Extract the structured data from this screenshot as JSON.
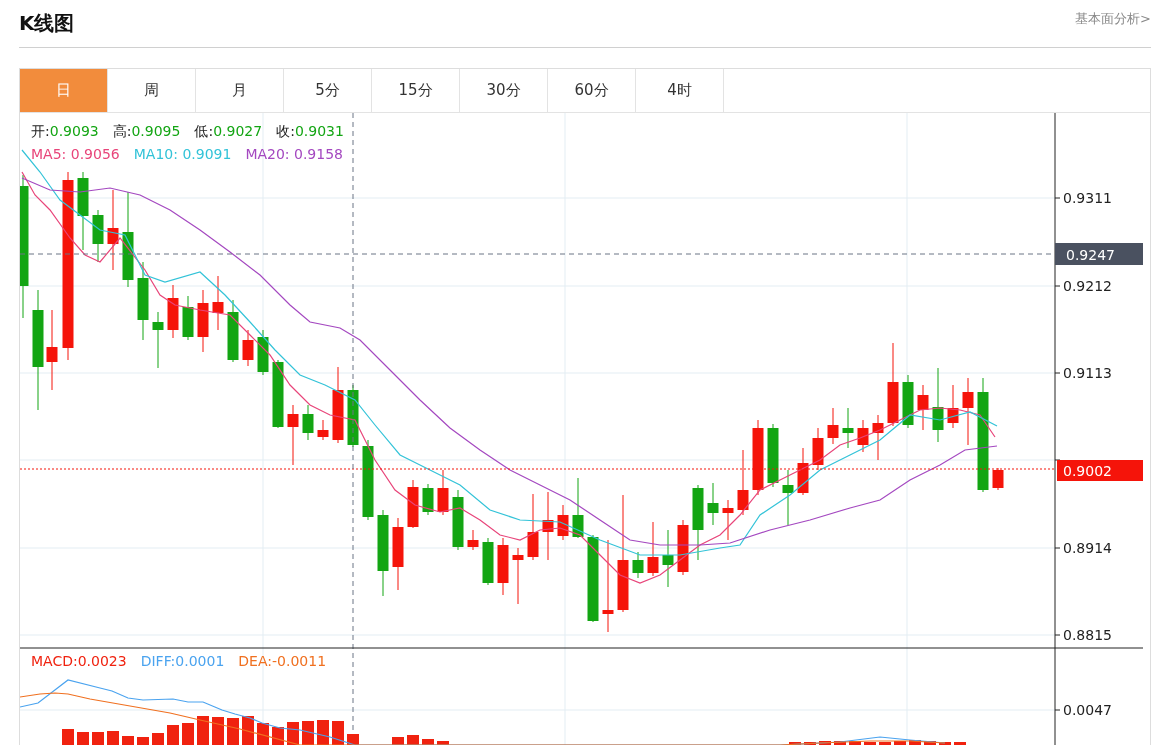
{
  "header": {
    "title": "K线图",
    "link": "基本面分析>"
  },
  "tabs": [
    {
      "label": "日",
      "selected": true
    },
    {
      "label": "周",
      "selected": false
    },
    {
      "label": "月",
      "selected": false
    },
    {
      "label": "5分",
      "selected": false
    },
    {
      "label": "15分",
      "selected": false
    },
    {
      "label": "30分",
      "selected": false
    },
    {
      "label": "60分",
      "selected": false
    },
    {
      "label": "4时",
      "selected": false
    }
  ],
  "ohlc": [
    {
      "label": "开:",
      "value": "0.9093"
    },
    {
      "label": "高:",
      "value": "0.9095"
    },
    {
      "label": "低:",
      "value": "0.9027"
    },
    {
      "label": "收:",
      "value": "0.9031"
    }
  ],
  "moving_averages": [
    {
      "label": "MA5:",
      "value": "0.9056",
      "color": "#e8457a"
    },
    {
      "label": "MA10:",
      "value": "0.9091",
      "color": "#33c3d8"
    },
    {
      "label": "MA20:",
      "value": "0.9158",
      "color": "#a448c0"
    }
  ],
  "price_axis": [
    "0.9311",
    "0.9212",
    "0.9113",
    "0.8914",
    "0.8815"
  ],
  "crosshair_price": "0.9247",
  "last_price": "0.9002",
  "macd": {
    "indicators": [
      {
        "label": "MACD:",
        "value": "0.0023",
        "color": "#f0220f"
      },
      {
        "label": "DIFF:",
        "value": "0.0001",
        "color": "#4aa3ef"
      },
      {
        "label": "DEA:",
        "value": "-0.0011",
        "color": "#f07020"
      }
    ],
    "axis": [
      "0.0047"
    ]
  }
}
